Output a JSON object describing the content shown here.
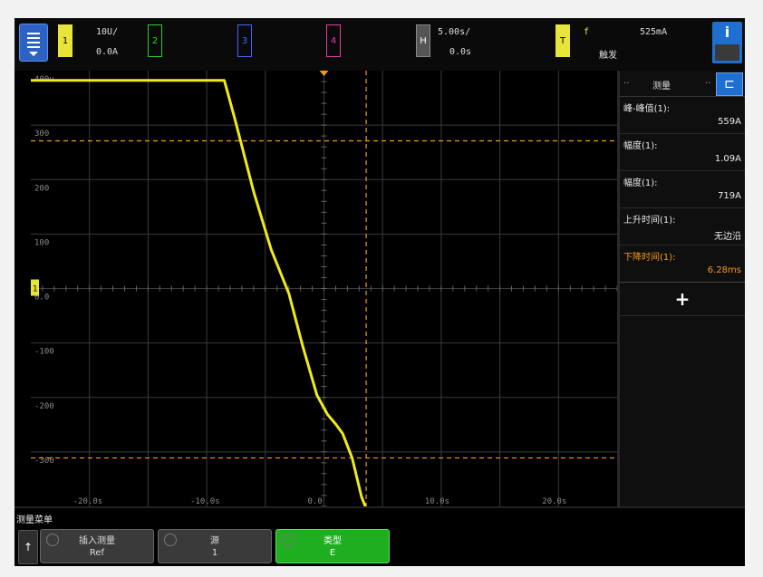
{
  "colors": {
    "trace": "#f1ea1a",
    "ch1": "#e8e43a",
    "ch2": "#2bd12b",
    "ch3": "#4a63ff",
    "ch4": "#e23ea2",
    "cursor": "#f39a1c",
    "accent": "#1e6fd0",
    "softkey_active": "#1fae1f"
  },
  "topbar": {
    "menu_icon": "menu-icon",
    "ch1": {
      "label": "1",
      "scale": "10U/",
      "offset": "0.0A"
    },
    "ch2": {
      "label": "2"
    },
    "ch3": {
      "label": "3"
    },
    "ch4": {
      "label": "4"
    },
    "timebase": {
      "label": "H",
      "scale": "5.00s/",
      "delay": "0.0s"
    },
    "trigger": {
      "label": "T",
      "mode": "f",
      "level": "525mA",
      "status": "触发"
    },
    "info_label": "i"
  },
  "graticule": {
    "y_labels": [
      "400u",
      "300",
      "200",
      "100",
      "0.0",
      "-100",
      "-200",
      "-300"
    ],
    "x_labels": [
      "-20.0s",
      "-10.0s",
      "0.0",
      "10.0s",
      "20.0s"
    ],
    "ground_marker": "1"
  },
  "panel": {
    "title": "测量",
    "tab_icon": "table-icon",
    "measurements": [
      {
        "label": "峰-峰值(1):",
        "value": "559A",
        "orange": false
      },
      {
        "label": "幅度(1):",
        "value": "1.09A",
        "orange": false
      },
      {
        "label": "幅度(1):",
        "value": "719A",
        "orange": false
      },
      {
        "label": "上升时间(1):",
        "value": "无边沿",
        "orange": false
      },
      {
        "label": "下降时间(1):",
        "value": "6.28ms",
        "orange": true
      }
    ],
    "add_label": "+"
  },
  "softkeys": {
    "title": "测量菜单",
    "back": "↑",
    "keys": [
      {
        "top": "插入测量",
        "bottom": "Ref",
        "active": false
      },
      {
        "top": "源",
        "bottom": "1",
        "active": false
      },
      {
        "top": "类型",
        "bottom": "E",
        "active": true
      }
    ]
  },
  "chart_data": {
    "type": "line",
    "series": [
      {
        "x": [
          -25,
          -8.5,
          -7.6,
          -6.0,
          -4.5,
          -3.0,
          -1.8,
          -0.6,
          0.3,
          1.0,
          1.6,
          2.4,
          3.2,
          4.0,
          5.0,
          7.0,
          10.0,
          15.0,
          25.0
        ],
        "y": [
          480,
          480,
          400,
          250,
          130,
          40,
          -70,
          -170,
          -210,
          -230,
          -250,
          -300,
          -380,
          -430,
          -450,
          -455,
          -455,
          -455,
          -455
        ]
      }
    ],
    "x_range": [
      -25,
      25
    ],
    "y_range": [
      -400,
      500
    ],
    "grid": true
  }
}
